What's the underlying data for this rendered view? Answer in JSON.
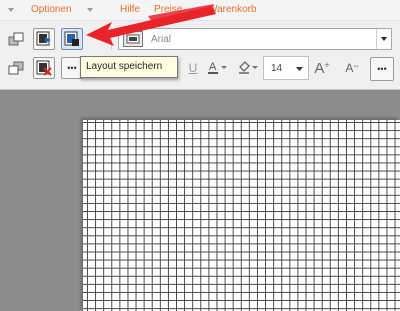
{
  "menu": {
    "items": [
      "Optionen",
      "Hilfe",
      "Preise",
      "Warenkorb"
    ]
  },
  "toolbar": {
    "font_name": "Arial",
    "font_size": "14",
    "underline_label": "U",
    "grow_font_label": "A",
    "shrink_font_label": "A",
    "more_label": "•••",
    "more_small_label": "•••"
  },
  "tooltip": {
    "text": "Layout speichern"
  },
  "colors": {
    "menu_text": "#e8702a",
    "annotation_arrow": "#e8232a"
  }
}
